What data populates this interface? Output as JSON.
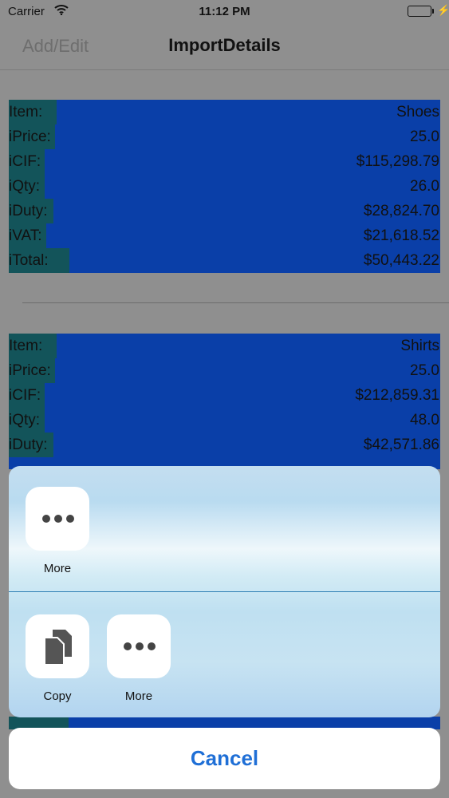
{
  "status_bar": {
    "carrier": "Carrier",
    "time": "11:12 PM",
    "battery_level": 1.0,
    "battery_color": "#4cd964"
  },
  "nav_bar": {
    "left_button": "Add/Edit",
    "title": "ImportDetails"
  },
  "records": [
    {
      "rows": [
        {
          "label": "Item:",
          "value": "Shoes"
        },
        {
          "label": "iPrice:",
          "value": "25.0"
        },
        {
          "label": "iCIF:",
          "value": "$115,298.79"
        },
        {
          "label": "iQty:",
          "value": "26.0"
        },
        {
          "label": "iDuty:",
          "value": "$28,824.70"
        },
        {
          "label": "iVAT:",
          "value": "$21,618.52"
        },
        {
          "label": "iTotal:",
          "value": "$50,443.22"
        }
      ]
    },
    {
      "rows": [
        {
          "label": "Item:",
          "value": "Shirts"
        },
        {
          "label": "iPrice:",
          "value": "25.0"
        },
        {
          "label": "iCIF:",
          "value": "$212,859.31"
        },
        {
          "label": "iQty:",
          "value": "48.0"
        },
        {
          "label": "iDuty:",
          "value": "$42,571.86"
        }
      ]
    }
  ],
  "share_sheet": {
    "top_row": [
      {
        "icon": "more-icon",
        "label": "More"
      }
    ],
    "bottom_row": [
      {
        "icon": "copy-icon",
        "label": "Copy"
      },
      {
        "icon": "more-icon",
        "label": "More"
      }
    ],
    "cancel_label": "Cancel",
    "accent_color": "#1f6fd6",
    "record_fill_color": "#0a3fa8",
    "label_fill_color": "#13545a"
  }
}
